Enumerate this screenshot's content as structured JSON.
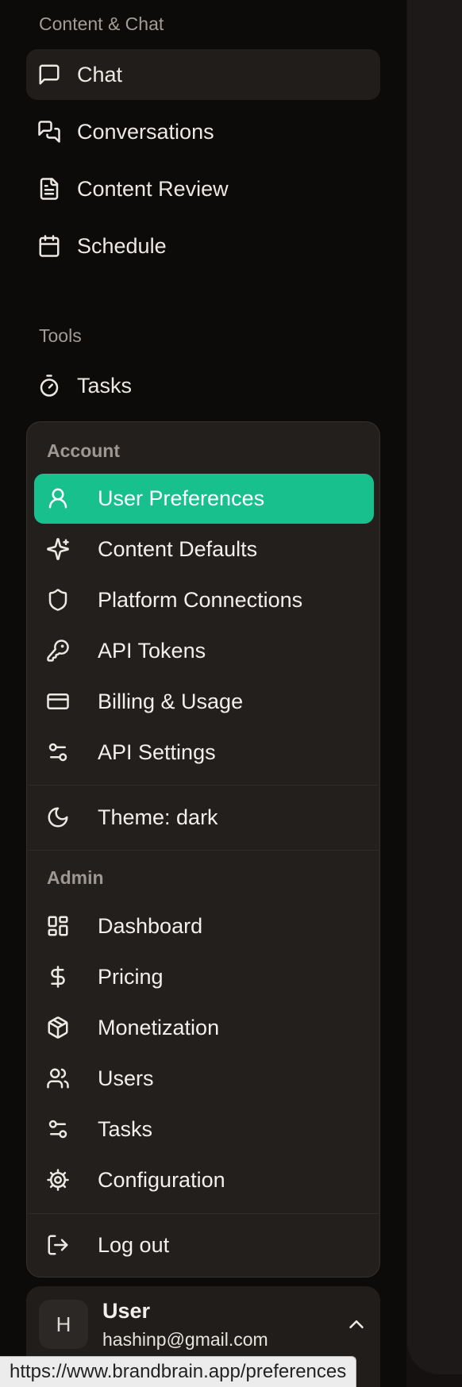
{
  "colors": {
    "background": "#0d0b0a",
    "active_nav": "#211d1b",
    "menu_bg": "#231f1d",
    "accent": "#18c08e"
  },
  "sidebar": {
    "content_section": {
      "label": "Content & Chat",
      "items": [
        {
          "label": "Chat",
          "icon": "message-square-icon",
          "active": true
        },
        {
          "label": "Conversations",
          "icon": "messages-icon",
          "active": false
        },
        {
          "label": "Content Review",
          "icon": "file-text-icon",
          "active": false
        },
        {
          "label": "Schedule",
          "icon": "calendar-icon",
          "active": false
        }
      ]
    },
    "tools_section": {
      "label": "Tools",
      "items": [
        {
          "label": "Tasks",
          "icon": "timer-icon"
        }
      ]
    }
  },
  "menu": {
    "account_label": "Account",
    "account_items": [
      {
        "label": "User Preferences",
        "icon": "user-icon",
        "active": true
      },
      {
        "label": "Content Defaults",
        "icon": "sparkles-icon"
      },
      {
        "label": "Platform Connections",
        "icon": "shield-icon"
      },
      {
        "label": "API Tokens",
        "icon": "key-icon"
      },
      {
        "label": "Billing & Usage",
        "icon": "credit-card-icon"
      },
      {
        "label": "API Settings",
        "icon": "settings-sliders-icon"
      }
    ],
    "theme_item": {
      "label": "Theme: dark",
      "icon": "moon-icon"
    },
    "admin_label": "Admin",
    "admin_items": [
      {
        "label": "Dashboard",
        "icon": "dashboard-icon"
      },
      {
        "label": "Pricing",
        "icon": "dollar-icon"
      },
      {
        "label": "Monetization",
        "icon": "package-icon"
      },
      {
        "label": "Users",
        "icon": "users-icon"
      },
      {
        "label": "Tasks",
        "icon": "settings-sliders-icon"
      },
      {
        "label": "Configuration",
        "icon": "cog-icon"
      }
    ],
    "logout_item": {
      "label": "Log out",
      "icon": "log-out-icon"
    }
  },
  "user": {
    "avatar_initial": "H",
    "name": "User",
    "email": "hashinp@gmail.com",
    "chevron_icon": "chevron-up-icon"
  },
  "status_bar": {
    "url": "https://www.brandbrain.app/preferences"
  }
}
